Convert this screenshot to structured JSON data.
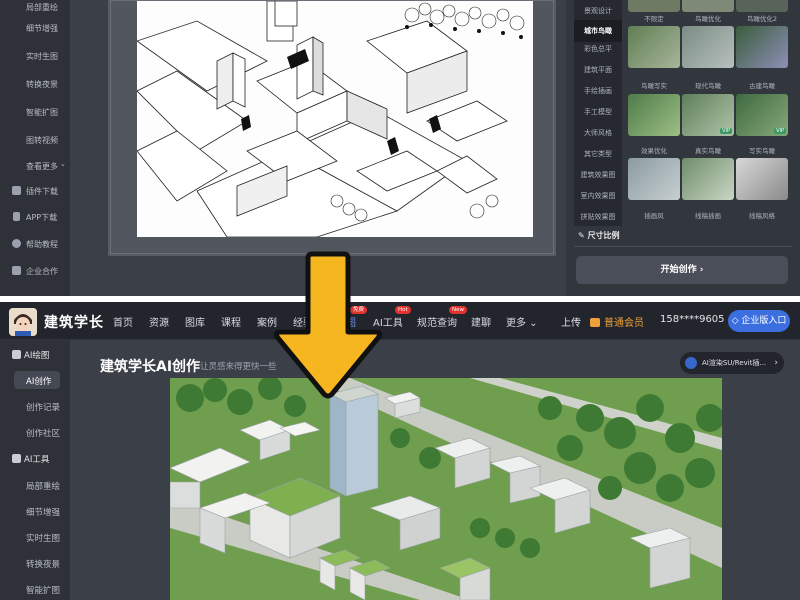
{
  "top_sidebar": {
    "items": [
      {
        "label": "局部重绘",
        "icon": ""
      },
      {
        "label": "细节增强",
        "icon": ""
      },
      {
        "label": "实时生图",
        "icon": ""
      },
      {
        "label": "转换夜景",
        "icon": ""
      },
      {
        "label": "智能扩图",
        "icon": ""
      },
      {
        "label": "图转视频",
        "icon": ""
      },
      {
        "label": "查看更多",
        "icon": "chevron-down-icon"
      },
      {
        "label": "插件下载",
        "icon": "puzzle-icon"
      },
      {
        "label": "APP下载",
        "icon": "phone-icon"
      },
      {
        "label": "帮助教程",
        "icon": "help-icon"
      },
      {
        "label": "企业合作",
        "icon": "building-icon"
      }
    ]
  },
  "top_right": {
    "style_tabs": [
      "景观设计",
      "城市鸟瞰",
      "彩色总平",
      "建筑平面",
      "手绘插画",
      "手工模型",
      "大师风格",
      "其它类型",
      "建筑效果图",
      "室内效果图",
      "拼贴效果图"
    ],
    "active_tab": "城市鸟瞰",
    "thumbs": [
      {
        "caption": "不限定",
        "vip": false
      },
      {
        "caption": "鸟瞰优化",
        "vip": false
      },
      {
        "caption": "鸟瞰优化2",
        "vip": false
      },
      {
        "caption": "",
        "vip": false
      },
      {
        "caption": "",
        "vip": false
      },
      {
        "caption": "",
        "vip": false
      },
      {
        "caption": "鸟瞰写实",
        "vip": false
      },
      {
        "caption": "现代鸟瞰",
        "vip": false
      },
      {
        "caption": "古建鸟瞰",
        "vip": false
      },
      {
        "caption": "",
        "vip": false
      },
      {
        "caption": "",
        "vip": true
      },
      {
        "caption": "",
        "vip": true
      },
      {
        "caption": "效果优化",
        "vip": false
      },
      {
        "caption": "真实鸟瞰",
        "vip": false
      },
      {
        "caption": "写实鸟瞰",
        "vip": false
      },
      {
        "caption": "",
        "vip": false
      },
      {
        "caption": "",
        "vip": false
      },
      {
        "caption": "",
        "vip": false
      },
      {
        "caption": "插画风",
        "vip": false
      },
      {
        "caption": "线稿插画",
        "vip": false
      },
      {
        "caption": "线稿风格",
        "vip": false
      }
    ],
    "ratio_title": "尺寸比例",
    "start_button": "开始创作 ›"
  },
  "nav": {
    "logo_text": "建筑学长",
    "items": [
      {
        "label": "首页",
        "badge": ""
      },
      {
        "label": "资源",
        "badge": ""
      },
      {
        "label": "图库",
        "badge": ""
      },
      {
        "label": "课程",
        "badge": ""
      },
      {
        "label": "案例",
        "badge": ""
      },
      {
        "label": "经验",
        "badge": ""
      },
      {
        "label": "绘图",
        "badge": "免费"
      },
      {
        "label": "AI工具",
        "badge": "Hot"
      },
      {
        "label": "规范查询",
        "badge": "New"
      },
      {
        "label": "建聊",
        "badge": ""
      },
      {
        "label": "更多",
        "badge": ""
      }
    ],
    "upload": "上传",
    "member": "普通会员",
    "phone": "158****9605",
    "enterprise": "企业版入口"
  },
  "bottom_sidebar": {
    "items": [
      {
        "label": "AI绘图",
        "type": "section",
        "icon": "palette-icon"
      },
      {
        "label": "AI创作",
        "type": "item",
        "active": true
      },
      {
        "label": "创作记录",
        "type": "item"
      },
      {
        "label": "创作社区",
        "type": "item"
      },
      {
        "label": "AI工具",
        "type": "section",
        "icon": "toolbox-icon"
      },
      {
        "label": "局部重绘",
        "type": "item"
      },
      {
        "label": "细节增强",
        "type": "item"
      },
      {
        "label": "实时生图",
        "type": "item"
      },
      {
        "label": "转换夜景",
        "type": "item"
      },
      {
        "label": "智能扩图",
        "type": "item"
      }
    ]
  },
  "main": {
    "title": "建筑学长AI创作",
    "subtitle": "让灵感来得更快一些",
    "ai_pill": "AI渲染SU/Revit插..."
  },
  "colors": {
    "accent_blue": "#3b6fe0",
    "member_orange": "#f0a13a",
    "badge_red": "#e0322f",
    "arrow_yellow": "#f6b620",
    "dark_bg": "#3b3f47"
  }
}
